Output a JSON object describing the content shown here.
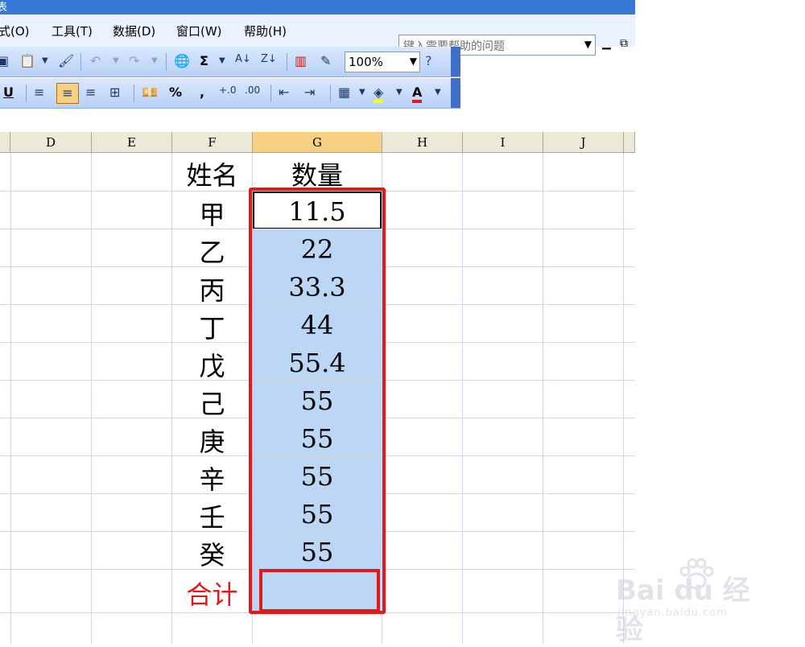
{
  "window": {
    "title_fragment": "表"
  },
  "menu": {
    "items": [
      "式(O)",
      "工具(T)",
      "数据(D)",
      "窗口(W)",
      "帮助(H)"
    ],
    "help_placeholder": "键入需要帮助的问题"
  },
  "toolbar": {
    "zoom": "100%",
    "sigma": "Σ",
    "percent": "%",
    "comma": ",",
    "underline": "U",
    "font_color_letter": "A"
  },
  "sheet": {
    "columns": [
      "D",
      "E",
      "F",
      "G",
      "H",
      "I",
      "J"
    ],
    "active_column": "G",
    "header": {
      "name": "姓名",
      "qty": "数量"
    },
    "rows": [
      {
        "name": "甲",
        "qty": "11.5"
      },
      {
        "name": "乙",
        "qty": "22"
      },
      {
        "name": "丙",
        "qty": "33.3"
      },
      {
        "name": "丁",
        "qty": "44"
      },
      {
        "name": "戊",
        "qty": "55.4"
      },
      {
        "name": "己",
        "qty": "55"
      },
      {
        "name": "庚",
        "qty": "55"
      },
      {
        "name": "辛",
        "qty": "55"
      },
      {
        "name": "壬",
        "qty": "55"
      },
      {
        "name": "癸",
        "qty": "55"
      }
    ],
    "total_label": "合计",
    "total_value": ""
  },
  "colors": {
    "highlight": "#e31818",
    "selection": "#bcd7f6"
  },
  "watermark": {
    "brand": "Bai du 经验",
    "url": "jingyan.baidu.com"
  }
}
